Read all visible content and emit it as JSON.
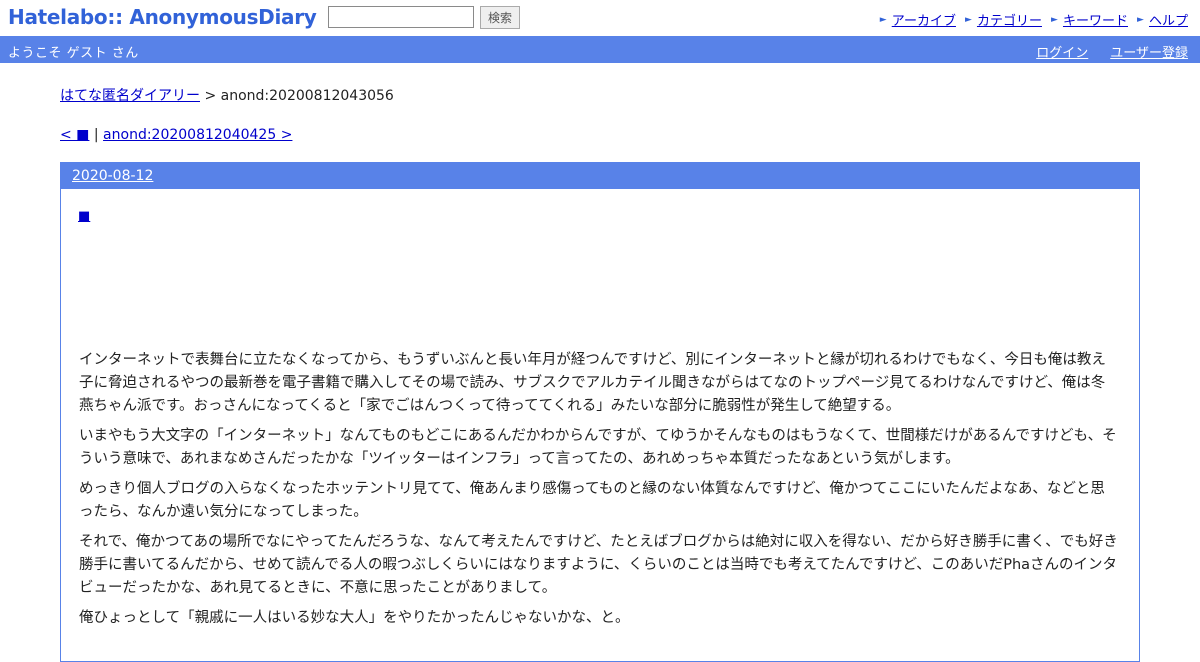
{
  "header": {
    "logo": "Hatelabo:: AnonymousDiary",
    "search_value": "",
    "search_button": "検索",
    "nav": [
      {
        "label": "アーカイブ",
        "icon": "arrow-right-icon"
      },
      {
        "label": "カテゴリー",
        "icon": "arrow-right-icon"
      },
      {
        "label": "キーワード",
        "icon": "arrow-right-icon"
      },
      {
        "label": "ヘルプ",
        "icon": "arrow-right-icon"
      }
    ]
  },
  "userbar": {
    "welcome": "ようこそ ゲスト さん",
    "login": "ログイン",
    "register": "ユーザー登録"
  },
  "breadcrumb": {
    "home": "はてな匿名ダイアリー",
    "separator": ">",
    "current": "anond:20200812043056"
  },
  "pager": {
    "prev": "< ■",
    "divider": "|",
    "next": "anond:20200812040425 >"
  },
  "day": {
    "date": "2020-08-12",
    "entry_anchor": "■",
    "paragraphs": [
      "インターネットで表舞台に立たなくなってから、もうずいぶんと長い年月が経つんですけど、別にインターネットと縁が切れるわけでもなく、今日も俺は教え子に脅迫されるやつの最新巻を電子書籍で購入してその場で読み、サブスクでアルカテイル聞きながらはてなのトップページ見てるわけなんですけど、俺は冬燕ちゃん派です。おっさんになってくると「家でごはんつくって待っててくれる」みたいな部分に脆弱性が発生して絶望する。",
      "いまやもう大文字の「インターネット」なんてものもどこにあるんだかわからんですが、てゆうかそんなものはもうなくて、世間様だけがあるんですけども、そういう意味で、あれまなめさんだったかな「ツイッターはインフラ」って言ってたの、あれめっちゃ本質だったなあという気がします。",
      "めっきり個人ブログの入らなくなったホッテントリ見てて、俺あんまり感傷ってものと縁のない体質なんですけど、俺かつてここにいたんだよなあ、などと思ったら、なんか遠い気分になってしまった。",
      "それで、俺かつてあの場所でなにやってたんだろうな、なんて考えたんですけど、たとえばブログからは絶対に収入を得ない、だから好き勝手に書く、でも好き勝手に書いてるんだから、せめて読んでる人の暇つぶしくらいにはなりますように、くらいのことは当時でも考えてたんですけど、このあいだPhaさんのインタビューだったかな、あれ見てるときに、不意に思ったことがありまして。",
      "俺ひょっとして「親戚に一人はいる妙な大人」をやりたかったんじゃないかな、と。"
    ]
  }
}
